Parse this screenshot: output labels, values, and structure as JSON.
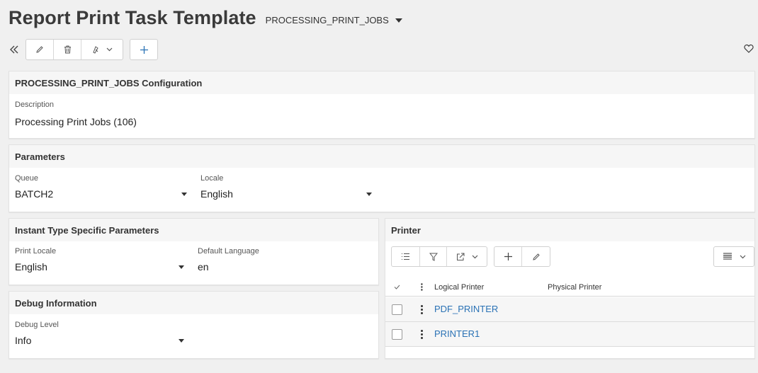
{
  "header": {
    "title": "Report Print Task Template",
    "record_selector": "PROCESSING_PRINT_JOBS"
  },
  "toolbar": {
    "back_icon": "double-chevron-left-icon",
    "edit_icon": "pencil-icon",
    "delete_icon": "trash-icon",
    "actions_icon": "actions-icon",
    "add_icon": "plus-icon",
    "favorite_icon": "heart-icon"
  },
  "config_card": {
    "title": "PROCESSING_PRINT_JOBS Configuration",
    "description_label": "Description",
    "description_value": "Processing Print Jobs (106)"
  },
  "parameters_card": {
    "title": "Parameters",
    "queue_label": "Queue",
    "queue_value": "BATCH2",
    "locale_label": "Locale",
    "locale_value": "English"
  },
  "instant_card": {
    "title": "Instant Type Specific Parameters",
    "print_locale_label": "Print Locale",
    "print_locale_value": "English",
    "default_language_label": "Default Language",
    "default_language_value": "en"
  },
  "debug_card": {
    "title": "Debug Information",
    "debug_level_label": "Debug Level",
    "debug_level_value": "Info"
  },
  "printer_card": {
    "title": "Printer",
    "columns": [
      "Logical Printer",
      "Physical Printer"
    ],
    "rows": [
      {
        "logical_printer": "PDF_PRINTER",
        "physical_printer": ""
      },
      {
        "logical_printer": "PRINTER1",
        "physical_printer": ""
      }
    ]
  },
  "colors": {
    "link": "#2a72b5",
    "accent_blue": "#2a72b5",
    "background": "#f0f0f0"
  }
}
